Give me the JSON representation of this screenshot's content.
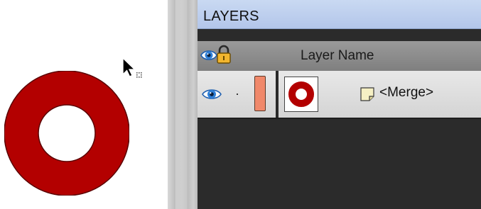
{
  "canvas": {
    "ring_color": "#b30000",
    "cursor_icon": "arrow-pointer-icon"
  },
  "layers_panel": {
    "title": "LAYERS",
    "header": {
      "visibility_icon": "eye-icon",
      "lock_icon": "lock-icon",
      "column_label": "Layer Name"
    },
    "rows": [
      {
        "visibility_icon": "eye-icon",
        "lock_state": "·",
        "label_color": "#f0886a",
        "thumbnail": "ring-thumbnail",
        "type_icon": "sticky-note-icon",
        "name": "<Merge>"
      }
    ]
  }
}
